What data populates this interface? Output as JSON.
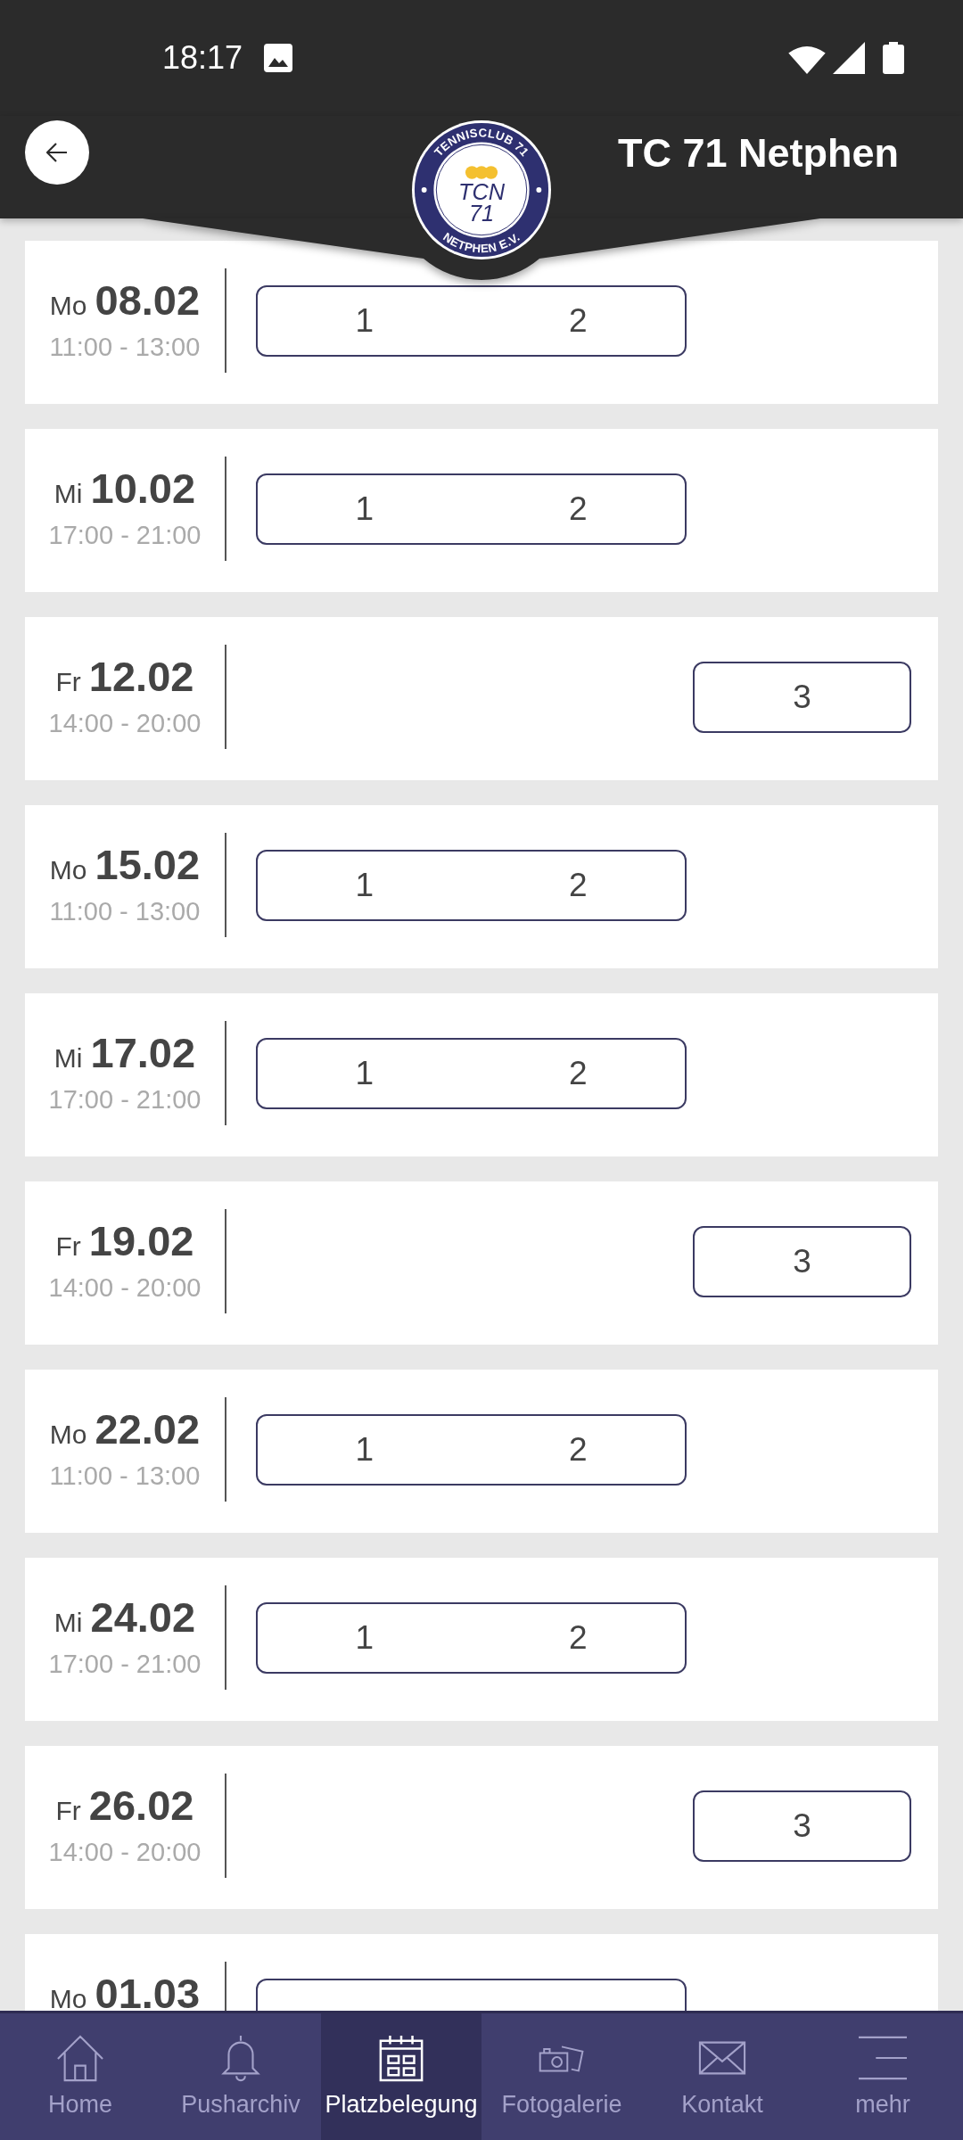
{
  "status_bar": {
    "time": "18:17"
  },
  "app_bar": {
    "title": "TC 71 Netphen",
    "logo": {
      "ring_top": "TENNISCLUB 71",
      "ring_bottom": "NETPHEN E.V.",
      "monogram": "TCN",
      "number": "71"
    }
  },
  "days": [
    {
      "weekday": "Mo",
      "date": "08.02",
      "time": "11:00 - 13:00",
      "booking": {
        "kind": "pair",
        "courts": [
          "1",
          "2"
        ]
      }
    },
    {
      "weekday": "Mi",
      "date": "10.02",
      "time": "17:00 - 21:00",
      "booking": {
        "kind": "pair",
        "courts": [
          "1",
          "2"
        ]
      }
    },
    {
      "weekday": "Fr",
      "date": "12.02",
      "time": "14:00 - 20:00",
      "booking": {
        "kind": "single",
        "courts": [
          "3"
        ]
      }
    },
    {
      "weekday": "Mo",
      "date": "15.02",
      "time": "11:00 - 13:00",
      "booking": {
        "kind": "pair",
        "courts": [
          "1",
          "2"
        ]
      }
    },
    {
      "weekday": "Mi",
      "date": "17.02",
      "time": "17:00 - 21:00",
      "booking": {
        "kind": "pair",
        "courts": [
          "1",
          "2"
        ]
      }
    },
    {
      "weekday": "Fr",
      "date": "19.02",
      "time": "14:00 - 20:00",
      "booking": {
        "kind": "single",
        "courts": [
          "3"
        ]
      }
    },
    {
      "weekday": "Mo",
      "date": "22.02",
      "time": "11:00 - 13:00",
      "booking": {
        "kind": "pair",
        "courts": [
          "1",
          "2"
        ]
      }
    },
    {
      "weekday": "Mi",
      "date": "24.02",
      "time": "17:00 - 21:00",
      "booking": {
        "kind": "pair",
        "courts": [
          "1",
          "2"
        ]
      }
    },
    {
      "weekday": "Fr",
      "date": "26.02",
      "time": "14:00 - 20:00",
      "booking": {
        "kind": "single",
        "courts": [
          "3"
        ]
      }
    },
    {
      "weekday": "Mo",
      "date": "01.03",
      "booking": {
        "kind": "pair"
      }
    }
  ],
  "nav": [
    {
      "label": "Home",
      "selected": false
    },
    {
      "label": "Pusharchiv",
      "selected": false
    },
    {
      "label": "Platzbelegung",
      "selected": true
    },
    {
      "label": "Fotogalerie",
      "selected": false
    },
    {
      "label": "Kontakt",
      "selected": false
    },
    {
      "label": "mehr",
      "selected": false
    }
  ]
}
